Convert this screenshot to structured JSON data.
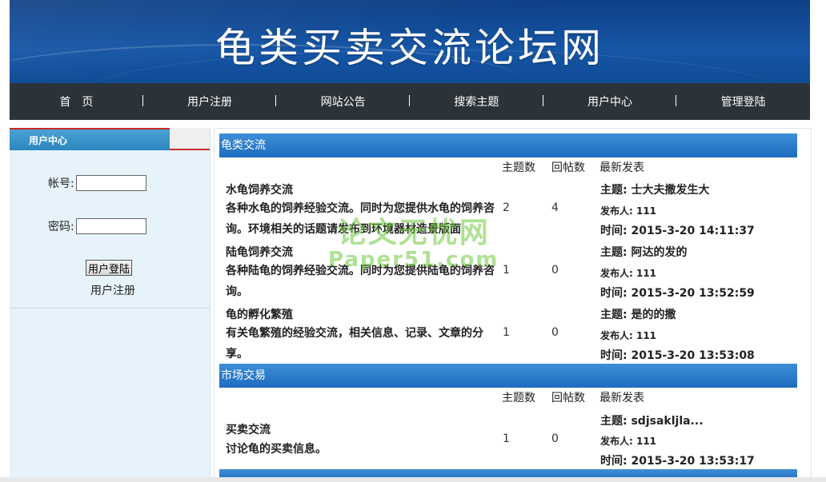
{
  "site": {
    "title": "龟类买卖交流论坛网"
  },
  "nav": {
    "items": [
      "首　页",
      "用户注册",
      "网站公告",
      "搜索主题",
      "用户中心",
      "管理登陆"
    ]
  },
  "sidebar": {
    "header": "用户中心",
    "account_label": "帐号:",
    "account_value": "",
    "password_label": "密码:",
    "password_value": "",
    "login_button": "用户登陆",
    "register_link": "用户注册"
  },
  "columns": {
    "topics": "主题数",
    "replies": "回帖数",
    "latest": "最新发表"
  },
  "sections": [
    {
      "name": "龟类交流",
      "forums": [
        {
          "title": "水龟饲养交流",
          "desc": "各种水龟的饲养经验交流。同时为您提供水龟的饲养咨询。环境相关的话题请发布到环境器材造景版面",
          "topics": "2",
          "replies": "4",
          "latest_topic": "主题: 士大夫撒发生大",
          "latest_author": "发布人: 111",
          "latest_time": "时间: 2015-3-20 14:11:37"
        },
        {
          "title": "陆龟饲养交流",
          "desc": "各种陆龟的饲养经验交流。同时为您提供陆龟的饲养咨询。",
          "topics": "1",
          "replies": "0",
          "latest_topic": "主题: 阿达的发的",
          "latest_author": "发布人: 111",
          "latest_time": "时间: 2015-3-20 13:52:59"
        },
        {
          "title": "龟的孵化繁殖",
          "desc": "有关龟繁殖的经验交流，相关信息、记录、文章的分享。",
          "topics": "1",
          "replies": "0",
          "latest_topic": "主题: 是的的撒",
          "latest_author": "发布人: 111",
          "latest_time": "时间: 2015-3-20 13:53:08"
        }
      ]
    },
    {
      "name": "市场交易",
      "forums": [
        {
          "title": "买卖交流",
          "desc": "讨论龟的买卖信息。",
          "topics": "1",
          "replies": "0",
          "latest_topic": "主题: sdjsakljla...",
          "latest_author": "发布人: 111",
          "latest_time": "时间: 2015-3-20 13:53:17"
        }
      ]
    }
  ],
  "watermark": {
    "cn": "论文无忧网",
    "en": "Paper51.com"
  },
  "colors": {
    "banner": "#1656a6",
    "nav": "#2c3338",
    "section_bar": "#2b7bcf",
    "sidebar": "#e6f3fa"
  }
}
